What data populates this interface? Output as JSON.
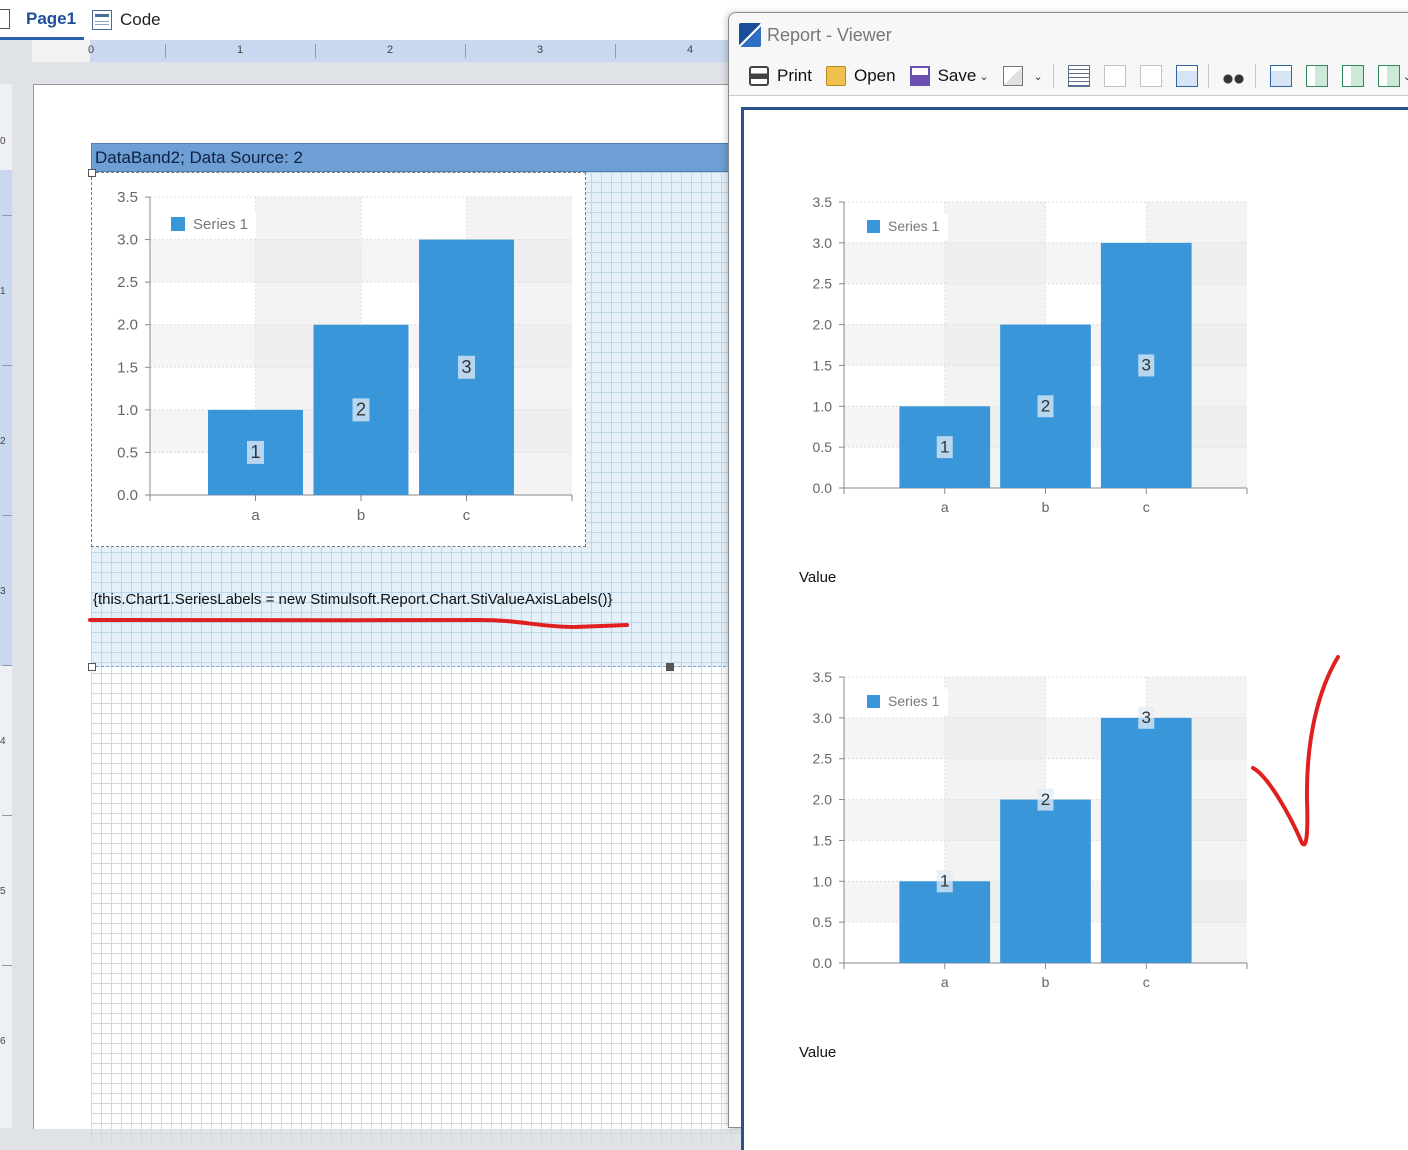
{
  "tabs": {
    "page_label": "Page1",
    "code_label": "Code"
  },
  "ruler": {
    "h_numbers": [
      "0",
      "1",
      "2",
      "3",
      "4"
    ],
    "v_numbers": [
      "0",
      "1",
      "2",
      "3",
      "4",
      "5",
      "6"
    ]
  },
  "designer": {
    "band_header": "DataBand2; Data Source: 2",
    "expression": "{this.Chart1.SeriesLabels = new Stimulsoft.Report.Chart.StiValueAxisLabels()}"
  },
  "viewer": {
    "title": "Report - Viewer",
    "toolbar": {
      "print": "Print",
      "open": "Open",
      "save": "Save"
    },
    "value_label_1": "Value",
    "value_label_2": "Value"
  },
  "colors": {
    "bar": "#3996d9",
    "band_header": "#6d9fd4",
    "annotation": "#e02020",
    "tab_accent": "#2a5fb0"
  },
  "annotations": {
    "underline_icon": "red-underline",
    "check_icon": "red-checkmark"
  },
  "chart_data": [
    {
      "type": "bar",
      "label_position": "center",
      "categories": [
        "a",
        "b",
        "c"
      ],
      "series": [
        {
          "name": "Series 1",
          "values": [
            1,
            2,
            3
          ]
        }
      ],
      "data_labels": [
        "1",
        "2",
        "3"
      ],
      "yticks": [
        "0.0",
        "0.5",
        "1.0",
        "1.5",
        "2.0",
        "2.5",
        "3.0",
        "3.5"
      ],
      "ylim": [
        0,
        3.5
      ],
      "legend": "top-left",
      "grid": true
    },
    {
      "type": "bar",
      "label_position": "center",
      "categories": [
        "a",
        "b",
        "c"
      ],
      "series": [
        {
          "name": "Series 1",
          "values": [
            1,
            2,
            3
          ]
        }
      ],
      "data_labels": [
        "1",
        "2",
        "3"
      ],
      "yticks": [
        "0.0",
        "0.5",
        "1.0",
        "1.5",
        "2.0",
        "2.5",
        "3.0",
        "3.5"
      ],
      "ylim": [
        0,
        3.5
      ],
      "legend": "top-left",
      "grid": true
    },
    {
      "type": "bar",
      "label_position": "top",
      "categories": [
        "a",
        "b",
        "c"
      ],
      "series": [
        {
          "name": "Series 1",
          "values": [
            1,
            2,
            3
          ]
        }
      ],
      "data_labels": [
        "1",
        "2",
        "3"
      ],
      "yticks": [
        "0.0",
        "0.5",
        "1.0",
        "1.5",
        "2.0",
        "2.5",
        "3.0",
        "3.5"
      ],
      "ylim": [
        0,
        3.5
      ],
      "legend": "top-left",
      "grid": true
    }
  ]
}
